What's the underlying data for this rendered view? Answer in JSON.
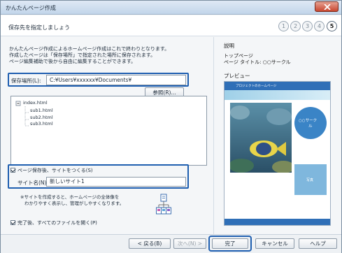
{
  "window": {
    "title": "かんたんページ作成"
  },
  "header": {
    "heading": "保存先を指定しましょう",
    "steps": [
      "1",
      "2",
      "3",
      "4",
      "5"
    ],
    "active_step": 5
  },
  "left": {
    "description_lines": [
      "かんたんページ作成によるホームページ作成はこれで終わりとなります。",
      "作成したページは「保存場所」で指定された場所に保存されます。",
      "ページ編集補助で後から自由に編集することができます。"
    ],
    "save_location": {
      "label": "保存場所(L):",
      "value": "C:¥Users¥xxxxxx¥Documents¥",
      "browse_label": "参照(R)..."
    },
    "tree": {
      "root": "index.html",
      "children": [
        "sub1.html",
        "sub2.html",
        "sub3.html"
      ]
    },
    "site_checkbox": {
      "label": "ページ保存後、サイトをつくる(S)",
      "checked": true
    },
    "site_name": {
      "label": "サイト名(N):",
      "value": "新しいサイト1"
    },
    "info_lines": [
      "※サイトを作成すると、ホームページの全体像を",
      "わかりやすく表示し、管理がしやすくなります。"
    ],
    "open_all_checkbox": {
      "label": "完了後、すべてのファイルを開く(P)",
      "checked": true
    }
  },
  "right": {
    "explanation_title": "説明",
    "explanation_lines": [
      "トップページ",
      "ページ タイトル: ○○サークル"
    ],
    "preview_label": "プレビュー",
    "preview": {
      "site_header": "プロジェクトのホームページ",
      "circle_text": "○○サーク",
      "circle_text2": "ル",
      "box_text": "写真"
    }
  },
  "buttons": {
    "back": "< 戻る(B)",
    "next": "次へ(N) >",
    "finish": "完了",
    "cancel": "キャンセル",
    "help": "ヘルプ"
  },
  "colors": {
    "highlight": "#1f5fb0",
    "close_button": "#c8462f"
  }
}
